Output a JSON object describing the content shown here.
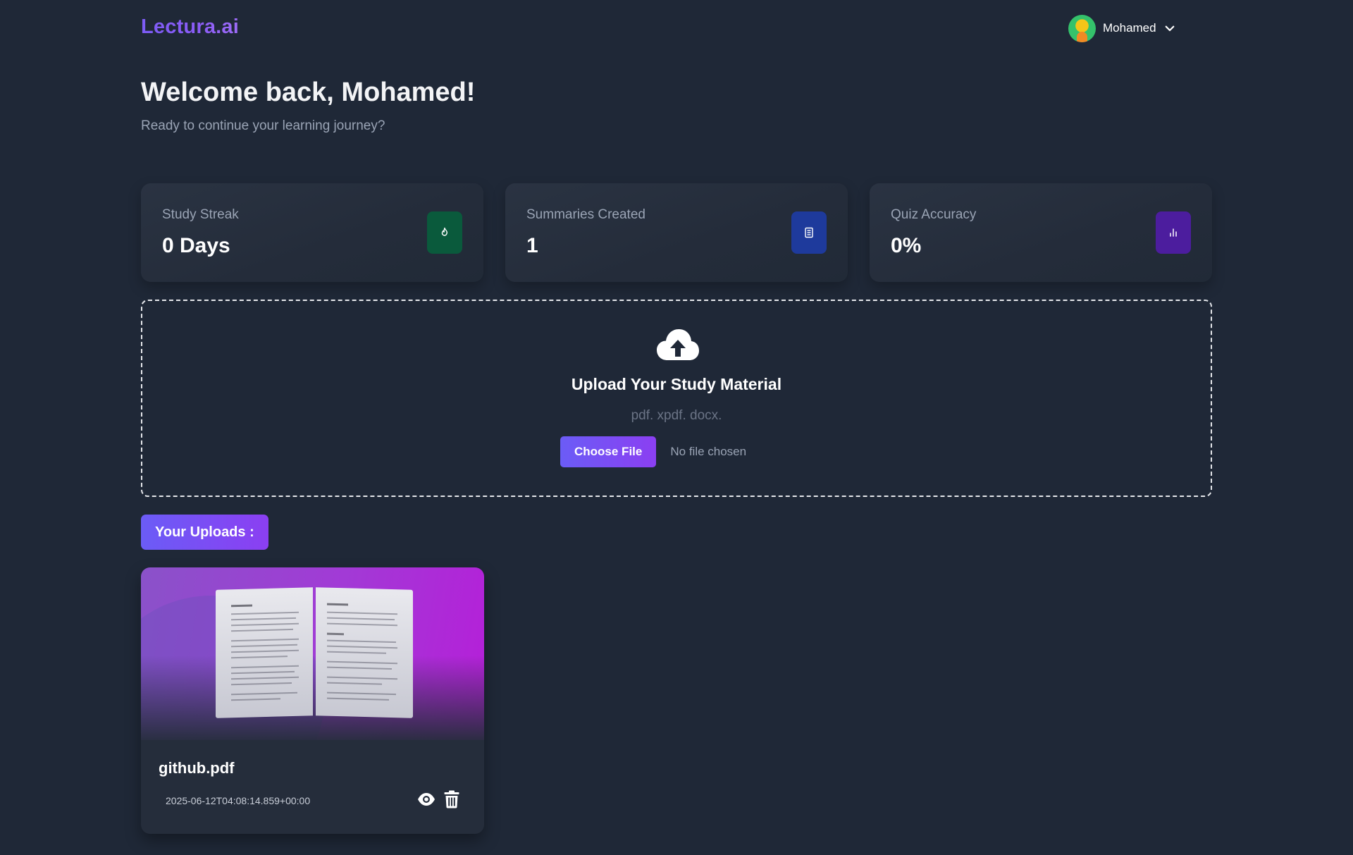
{
  "header": {
    "logo": "Lectura.ai",
    "user": {
      "name": "Mohamed"
    }
  },
  "welcome": {
    "title": "Welcome back, Mohamed!",
    "subtitle": "Ready to continue your learning journey?"
  },
  "stats": [
    {
      "label": "Study Streak",
      "value": "0 Days",
      "icon": "flame-icon",
      "color": "#0a5a3c"
    },
    {
      "label": "Summaries Created",
      "value": "1",
      "icon": "document-icon",
      "color": "#1e3a9c"
    },
    {
      "label": "Quiz Accuracy",
      "value": "0%",
      "icon": "bar-chart-icon",
      "color": "#4c1d9e"
    }
  ],
  "upload": {
    "title": "Upload Your Study Material",
    "types": "pdf. xpdf. docx.",
    "button_label": "Choose File",
    "file_status": "No file chosen"
  },
  "uploads": {
    "heading": "Your Uploads :",
    "items": [
      {
        "name": "github.pdf",
        "date": "2025-06-12T04:08:14.859+00:00"
      }
    ]
  },
  "colors": {
    "background": "#1f2837",
    "accent": "#7c5cf5"
  }
}
